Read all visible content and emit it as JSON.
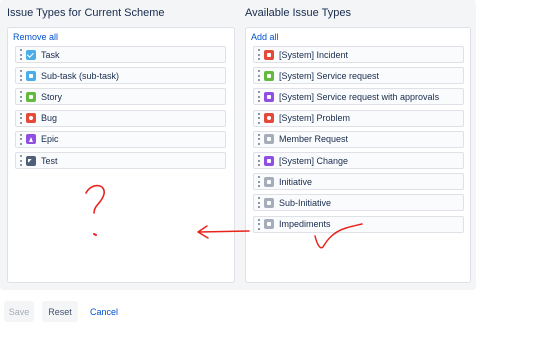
{
  "left": {
    "title": "Issue Types for Current Scheme",
    "remove_all": "Remove all",
    "items": [
      {
        "label": "Task",
        "icon": "task-icon",
        "color": "#4bade8",
        "glyph": "task"
      },
      {
        "label": "Sub-task (sub-task)",
        "icon": "subtask-icon",
        "color": "#4bade8",
        "glyph": "sq"
      },
      {
        "label": "Story",
        "icon": "story-icon",
        "color": "#63ba3c",
        "glyph": "sq"
      },
      {
        "label": "Bug",
        "icon": "bug-icon",
        "color": "#e5493a",
        "glyph": "dot"
      },
      {
        "label": "Epic",
        "icon": "epic-icon",
        "color": "#904ee2",
        "glyph": "bolt"
      },
      {
        "label": "Test",
        "icon": "test-icon",
        "color": "#505f79",
        "glyph": "test"
      }
    ]
  },
  "right": {
    "title": "Available Issue Types",
    "add_all": "Add all",
    "items": [
      {
        "label": "[System] Incident",
        "icon": "incident-icon",
        "color": "#e5493a",
        "glyph": "sq"
      },
      {
        "label": "[System] Service request",
        "icon": "service-request-icon",
        "color": "#63ba3c",
        "glyph": "sq"
      },
      {
        "label": "[System] Service request with approvals",
        "icon": "service-request-approvals-icon",
        "color": "#904ee2",
        "glyph": "sq"
      },
      {
        "label": "[System] Problem",
        "icon": "problem-icon",
        "color": "#e5493a",
        "glyph": "dot"
      },
      {
        "label": "Member Request",
        "icon": "member-request-icon",
        "color": "#a5adba",
        "glyph": "sq"
      },
      {
        "label": "[System] Change",
        "icon": "change-icon",
        "color": "#904ee2",
        "glyph": "sq"
      },
      {
        "label": "Initiative",
        "icon": "initiative-icon",
        "color": "#a5adba",
        "glyph": "sq"
      },
      {
        "label": "Sub-Initiative",
        "icon": "sub-initiative-icon",
        "color": "#a5adba",
        "glyph": "sq"
      },
      {
        "label": "Impediments",
        "icon": "impediments-icon",
        "color": "#a5adba",
        "glyph": "sq"
      }
    ]
  },
  "buttons": {
    "save": "Save",
    "reset": "Reset",
    "cancel": "Cancel"
  },
  "annotation": {
    "question_mark": "?",
    "color": "#e8231c"
  }
}
